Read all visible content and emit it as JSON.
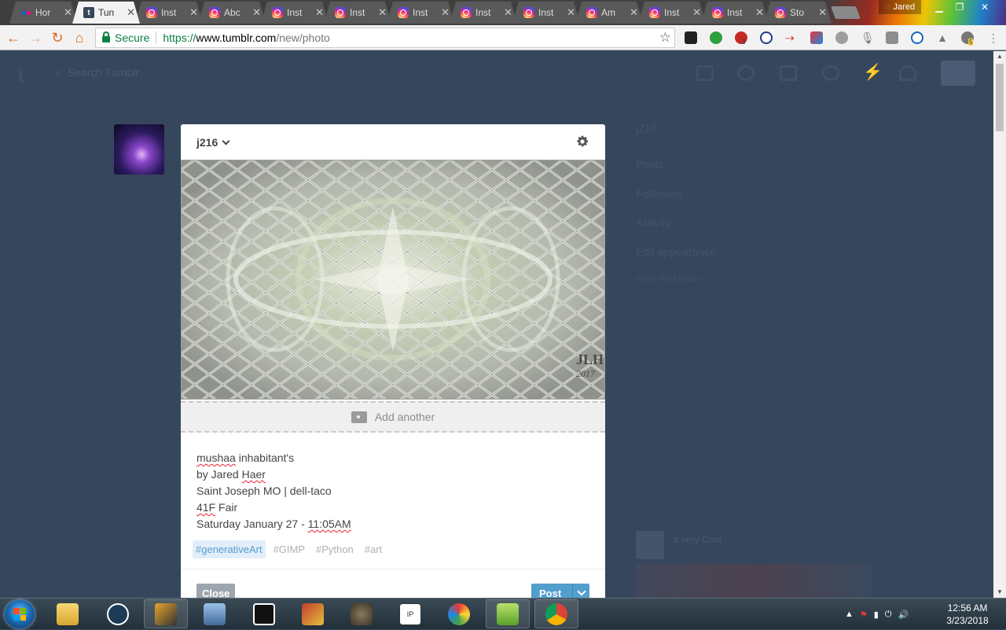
{
  "browser": {
    "tabs": [
      {
        "title": "Hor",
        "favicon": "flickr-icon",
        "active": false
      },
      {
        "title": "Tun",
        "favicon": "tumblr-icon",
        "active": true
      },
      {
        "title": "Inst",
        "favicon": "instagram-icon",
        "active": false
      },
      {
        "title": "Abc",
        "favicon": "instagram-icon",
        "active": false
      },
      {
        "title": "Inst",
        "favicon": "instagram-icon",
        "active": false
      },
      {
        "title": "Inst",
        "favicon": "instagram-icon",
        "active": false
      },
      {
        "title": "Inst",
        "favicon": "instagram-icon",
        "active": false
      },
      {
        "title": "Inst",
        "favicon": "instagram-icon",
        "active": false
      },
      {
        "title": "Inst",
        "favicon": "instagram-icon",
        "active": false
      },
      {
        "title": "Am",
        "favicon": "instagram-icon",
        "active": false
      },
      {
        "title": "Inst",
        "favicon": "instagram-icon",
        "active": false
      },
      {
        "title": "Inst",
        "favicon": "instagram-icon",
        "active": false
      },
      {
        "title": "Sto",
        "favicon": "instagram-icon",
        "active": false
      }
    ],
    "tab_close_glyph": "✕",
    "profile_name": "Jared",
    "secure_label": "Secure",
    "url_scheme": "https://",
    "url_host": "www.tumblr.com",
    "url_path": "/new/photo",
    "extension_badges": {
      "first": "3",
      "last": "5"
    }
  },
  "tumblr": {
    "logo": "t",
    "search_placeholder": "Search Tumblr"
  },
  "sidebar": {
    "blog_name": "j216",
    "items": [
      "Posts",
      "Followers",
      "Activity",
      "Edit appearance"
    ],
    "extra": "Mass Post Editor",
    "ghost_card": "a very Cool"
  },
  "post": {
    "blog_selector": "j216",
    "add_another": "Add another",
    "watermark_line1": "JLH",
    "watermark_line2": "2017",
    "caption": {
      "line1_word": "mushaa",
      "line1_rest": " inhabitant's",
      "line2_pre": "by Jared ",
      "line2_word": "Haer",
      "line3": "Saint Joseph MO | dell-taco",
      "line4_word": "41F",
      "line4_rest": " Fair",
      "line5_pre": "Saturday January 27 - ",
      "line5_word": "11:05AM"
    },
    "tags": [
      "#generativeArt",
      "#GIMP",
      "#Python",
      "#art"
    ],
    "close_label": "Close",
    "post_label": "Post"
  },
  "taskbar": {
    "clock_time": "12:56 AM",
    "clock_date": "3/23/2018"
  },
  "colors": {
    "dashboard_bg": "#36465d",
    "tumblr_blue": "#529ecc",
    "chrome_accent": "#d96a1c",
    "secure_green": "#0b8043"
  }
}
